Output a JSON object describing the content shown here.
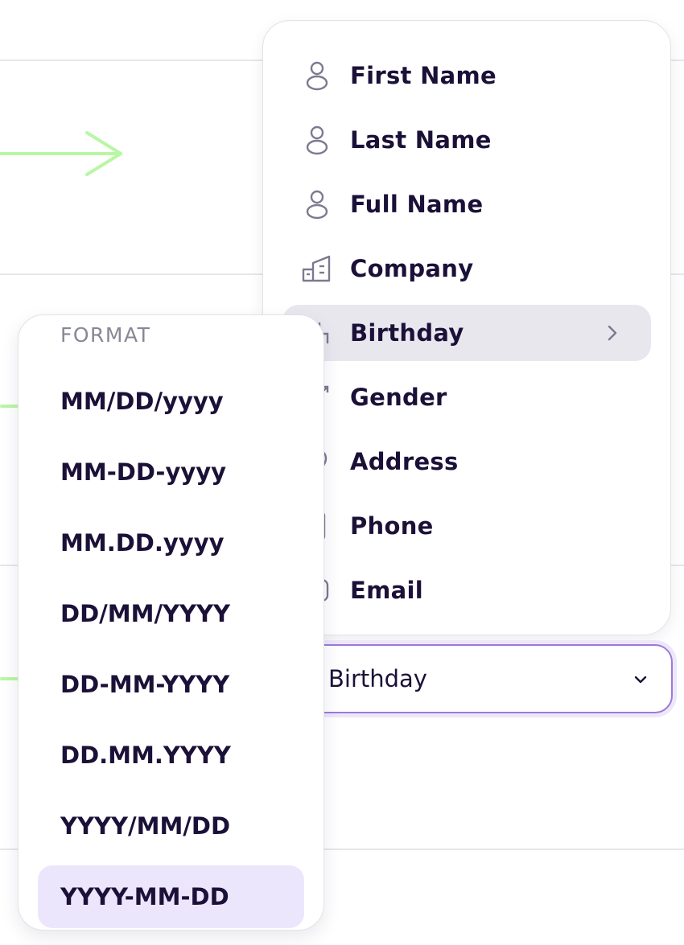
{
  "field_menu": {
    "items": [
      {
        "label": "First Name",
        "icon": "person-icon"
      },
      {
        "label": "Last Name",
        "icon": "person-icon"
      },
      {
        "label": "Full Name",
        "icon": "person-icon"
      },
      {
        "label": "Company",
        "icon": "building-icon"
      },
      {
        "label": "Birthday",
        "icon": "cake-icon"
      },
      {
        "label": "Gender",
        "icon": "gender-icon"
      },
      {
        "label": "Address",
        "icon": "location-icon"
      },
      {
        "label": "Phone",
        "icon": "phone-icon"
      },
      {
        "label": "Email",
        "icon": "email-icon"
      }
    ],
    "active": "Birthday"
  },
  "field_select": {
    "value": "Birthday"
  },
  "format_menu": {
    "title": "FORMAT",
    "items": [
      "MM/DD/yyyy",
      "MM-DD-yyyy",
      "MM.DD.yyyy",
      "DD/MM/YYYY",
      "DD-MM-YYYY",
      "DD.MM.YYYY",
      "YYYY/MM/DD",
      "YYYY-MM-DD"
    ],
    "active": "YYYY-MM-DD"
  },
  "colors": {
    "text": "#1b1138",
    "muted": "#8a8696",
    "accent": "#9b7bd6",
    "active_format_bg": "#ece6fd",
    "active_field_bg": "#e9e7ee",
    "arrow": "#b8f7a4"
  }
}
